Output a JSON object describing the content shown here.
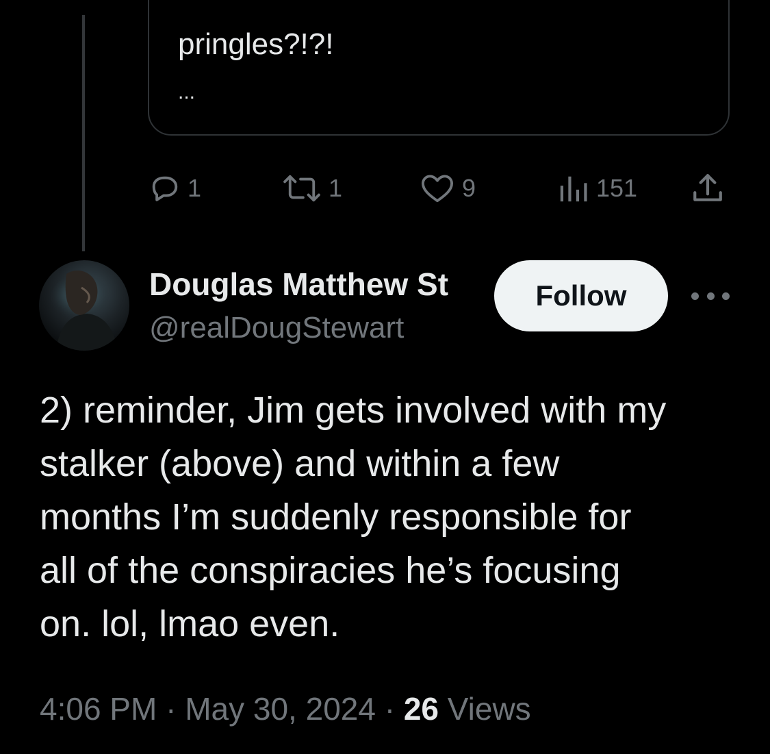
{
  "quoted_tweet": {
    "text": "pringles?!?!",
    "ellipsis": "..."
  },
  "action_bar": {
    "reply_count": "1",
    "repost_count": "1",
    "like_count": "9",
    "view_count": "151"
  },
  "author": {
    "display_name": "Douglas Matthew St",
    "handle": "@realDougStewart"
  },
  "follow_label": "Follow",
  "tweet": {
    "text": "2) reminder, Jim gets involved with my\nstalker (above) and within a few\nmonths I’m suddenly responsible for\nall of the conspiracies he’s focusing\non. lol, lmao even."
  },
  "meta": {
    "time": "4:06 PM",
    "separator": "·",
    "date": "May 30, 2024",
    "views_count": "26",
    "views_label": "Views"
  },
  "colors": {
    "background": "#000000",
    "text_primary": "#e7e9ea",
    "text_secondary": "#71767b",
    "border": "#2f3336",
    "follow_bg": "#eff3f4"
  },
  "icons": {
    "reply": "reply-icon",
    "repost": "repost-icon",
    "like": "heart-icon",
    "views": "views-chart-icon",
    "share": "share-icon",
    "more": "more-icon"
  }
}
